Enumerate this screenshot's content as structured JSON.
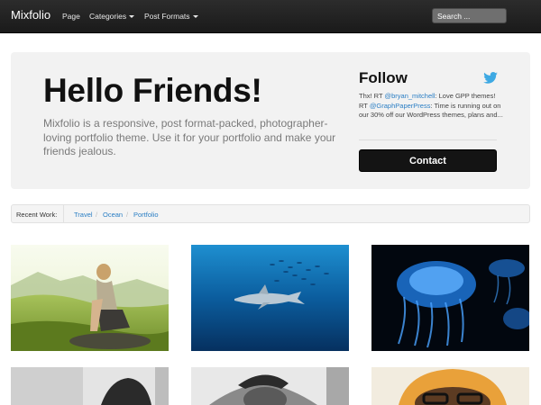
{
  "navbar": {
    "brand": "Mixfolio",
    "items": [
      {
        "label": "Page",
        "dropdown": false
      },
      {
        "label": "Categories",
        "dropdown": true
      },
      {
        "label": "Post Formats",
        "dropdown": true
      }
    ],
    "search_placeholder": "Search ..."
  },
  "hero": {
    "title": "Hello Friends!",
    "text": "Mixfolio is a responsive, post format-packed, photographer-loving portfolio theme. Use it for your portfolio and make your friends jealous."
  },
  "follow": {
    "title": "Follow",
    "icon": "twitter-bird-icon",
    "tweet": {
      "part1": "Thx! RT ",
      "mention1": "@bryan_mitchell",
      "part2": ": Love GPP themes! RT ",
      "mention2": "@GraphPaperPress",
      "part3": ": Time is running out on our 30% off our WordPress themes, plans and..."
    },
    "contact_label": "Contact"
  },
  "breadcrumb": {
    "label": "Recent Work:",
    "items": [
      "Travel",
      "Ocean",
      "Portfolio"
    ],
    "separator": "/"
  },
  "gallery": {
    "items": [
      {
        "alt": "woman sitting on rocks in a green valley",
        "icon": "photo-thumbnail"
      },
      {
        "alt": "shark swimming under a school of fish",
        "icon": "photo-thumbnail"
      },
      {
        "alt": "glowing blue jellyfish",
        "icon": "photo-thumbnail"
      },
      {
        "alt": "black and white portrait of a woman",
        "icon": "photo-thumbnail"
      },
      {
        "alt": "black and white portrait of a man in a cap",
        "icon": "photo-thumbnail"
      },
      {
        "alt": "man with orange headscarf and glasses",
        "icon": "photo-thumbnail"
      }
    ]
  },
  "colors": {
    "navbar": "#1f1f1f",
    "link": "#2a7ec4",
    "hero_background": "#f2f2f2",
    "button": "#141414"
  }
}
